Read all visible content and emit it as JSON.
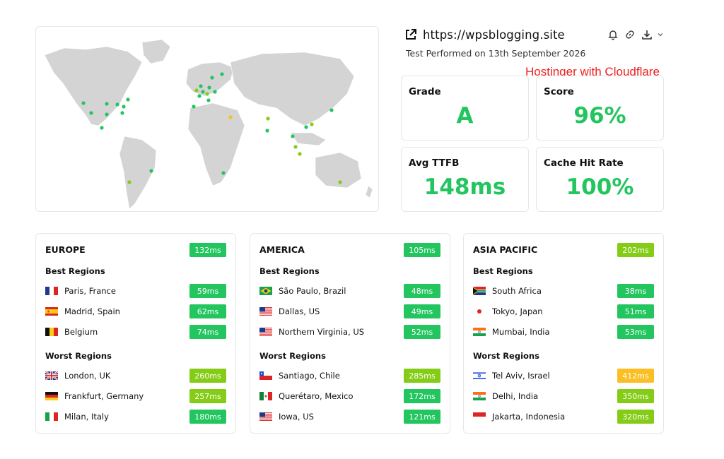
{
  "header": {
    "url": "https://wpsblogging.site",
    "test_date": "Test Performed on 13th September 2026",
    "note": "Hostinger with Cloudflare"
  },
  "metrics": [
    {
      "label": "Grade",
      "value": "A"
    },
    {
      "label": "Score",
      "value": "96%"
    },
    {
      "label": "Avg TTFB",
      "value": "148ms"
    },
    {
      "label": "Cache Hit Rate",
      "value": "100%"
    }
  ],
  "icons": [
    "external-link-icon",
    "bell-icon",
    "link-icon",
    "download-icon",
    "chevron-down-icon"
  ],
  "colors": {
    "good": "#22c55e",
    "ok": "#84cc16",
    "warn": "#fbbf24",
    "map_land": "#d4d4d4"
  },
  "regions": [
    {
      "title": "EUROPE",
      "latency": "132ms",
      "latency_color": "#22c55e",
      "best_label": "Best Regions",
      "worst_label": "Worst Regions",
      "best": [
        {
          "name": "Paris, France",
          "latency": "59ms",
          "color": "#22c55e",
          "flag": "fr"
        },
        {
          "name": "Madrid, Spain",
          "latency": "62ms",
          "color": "#22c55e",
          "flag": "es"
        },
        {
          "name": "Belgium",
          "latency": "74ms",
          "color": "#22c55e",
          "flag": "be"
        }
      ],
      "worst": [
        {
          "name": "London, UK",
          "latency": "260ms",
          "color": "#84cc16",
          "flag": "uk"
        },
        {
          "name": "Frankfurt, Germany",
          "latency": "257ms",
          "color": "#84cc16",
          "flag": "de"
        },
        {
          "name": "Milan, Italy",
          "latency": "180ms",
          "color": "#22c55e",
          "flag": "it"
        }
      ]
    },
    {
      "title": "AMERICA",
      "latency": "105ms",
      "latency_color": "#22c55e",
      "best_label": "Best Regions",
      "worst_label": "Worst Regions",
      "best": [
        {
          "name": "São Paulo, Brazil",
          "latency": "48ms",
          "color": "#22c55e",
          "flag": "br"
        },
        {
          "name": "Dallas, US",
          "latency": "49ms",
          "color": "#22c55e",
          "flag": "us"
        },
        {
          "name": "Northern Virginia, US",
          "latency": "52ms",
          "color": "#22c55e",
          "flag": "us"
        }
      ],
      "worst": [
        {
          "name": "Santiago, Chile",
          "latency": "285ms",
          "color": "#84cc16",
          "flag": "cl"
        },
        {
          "name": "Querétaro, Mexico",
          "latency": "172ms",
          "color": "#22c55e",
          "flag": "mx"
        },
        {
          "name": "Iowa, US",
          "latency": "121ms",
          "color": "#22c55e",
          "flag": "us"
        }
      ]
    },
    {
      "title": "ASIA PACIFIC",
      "latency": "202ms",
      "latency_color": "#84cc16",
      "best_label": "Best Regions",
      "worst_label": "Worst Regions",
      "best": [
        {
          "name": "South Africa",
          "latency": "38ms",
          "color": "#22c55e",
          "flag": "za"
        },
        {
          "name": "Tokyo, Japan",
          "latency": "51ms",
          "color": "#22c55e",
          "flag": "jp"
        },
        {
          "name": "Mumbai, India",
          "latency": "53ms",
          "color": "#22c55e",
          "flag": "in"
        }
      ],
      "worst": [
        {
          "name": "Tel Aviv, Israel",
          "latency": "412ms",
          "color": "#fbbf24",
          "flag": "il"
        },
        {
          "name": "Delhi, India",
          "latency": "350ms",
          "color": "#84cc16",
          "flag": "in"
        },
        {
          "name": "Jakarta, Indonesia",
          "latency": "320ms",
          "color": "#84cc16",
          "flag": "id"
        }
      ]
    }
  ]
}
